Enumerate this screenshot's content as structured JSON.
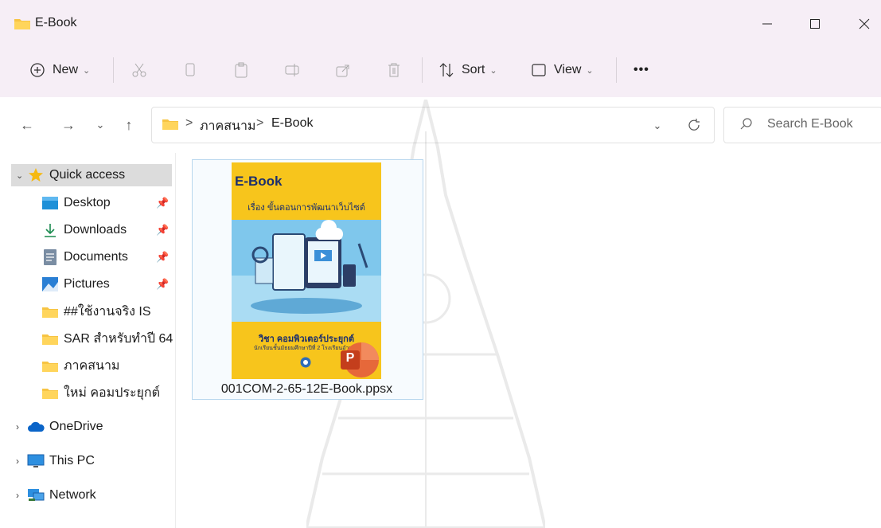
{
  "window": {
    "title": "E-Book",
    "controls": [
      "minimize",
      "maximize",
      "close"
    ]
  },
  "toolbar": {
    "new_label": "New",
    "sort_label": "Sort",
    "view_label": "View",
    "more_label": "•••",
    "disabled_actions": [
      "cut",
      "copy",
      "paste",
      "rename",
      "share",
      "delete"
    ]
  },
  "address": {
    "crumbs": [
      "ภาคสนาม",
      "E-Book"
    ],
    "separator": ">"
  },
  "search": {
    "placeholder": "Search E-Book"
  },
  "sidebar": {
    "quick_access_label": "Quick access",
    "quick_items": [
      {
        "label": "Desktop",
        "icon": "desktop-icon",
        "pinned": true
      },
      {
        "label": "Downloads",
        "icon": "download-icon",
        "pinned": true
      },
      {
        "label": "Documents",
        "icon": "document-icon",
        "pinned": true
      },
      {
        "label": "Pictures",
        "icon": "pictures-icon",
        "pinned": true
      },
      {
        "label": "##ใช้งานจริง IS",
        "icon": "folder-icon",
        "pinned": false
      },
      {
        "label": "SAR สำหรับทำปี 64",
        "icon": "folder-icon",
        "pinned": false
      },
      {
        "label": "ภาคสนาม",
        "icon": "folder-icon",
        "pinned": false
      },
      {
        "label": "ใหม่ คอมประยุกต์",
        "icon": "folder-icon",
        "pinned": false
      }
    ],
    "roots": [
      {
        "label": "OneDrive",
        "icon": "cloud-icon"
      },
      {
        "label": "This PC",
        "icon": "monitor-icon"
      },
      {
        "label": "Network",
        "icon": "network-icon"
      }
    ]
  },
  "files": [
    {
      "name": "001COM-2-65-12E-Book.ppsx",
      "thumbnail": {
        "title": "E-Book",
        "subtitle": "เรื่อง ขั้นตอนการพัฒนาเว็บไซต์",
        "footer_line1": "วิชา คอมพิวเตอร์ประยุกต์",
        "footer_line2": "นักเรียนชั้นมัธยมศึกษาปีที่ 2 โรงเรียนอำนาจ"
      },
      "app_badge": "P"
    }
  ],
  "colors": {
    "folder": "#f7c443",
    "accent": "#0067c0",
    "ppt": "#c43e1c",
    "cover": "#f7c51c"
  }
}
